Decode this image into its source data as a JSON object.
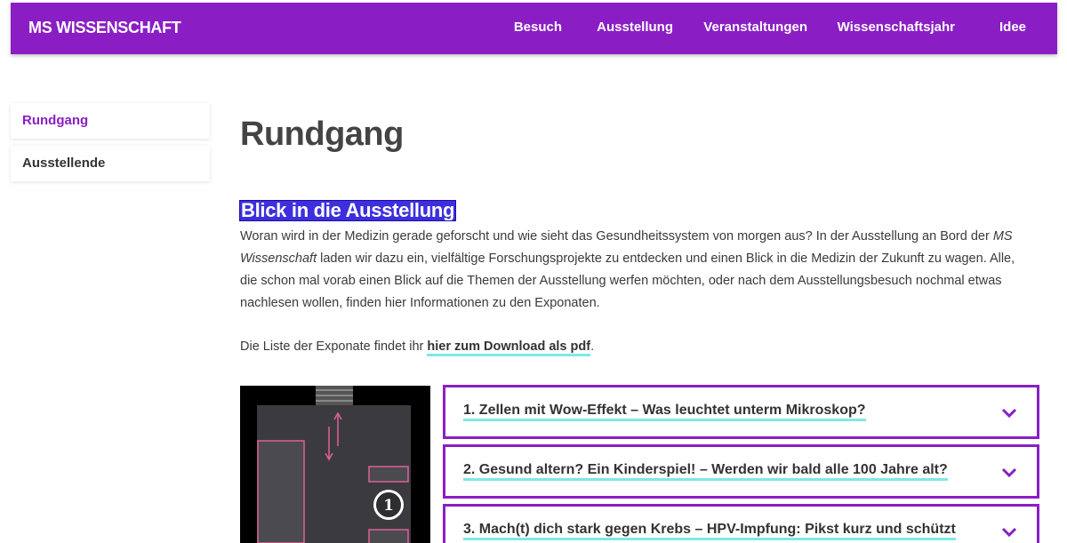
{
  "header": {
    "brand": "MS WISSENSCHAFT",
    "nav": [
      "Besuch",
      "Ausstellung",
      "Veranstaltungen",
      "Wissenschaftsjahr",
      "Idee"
    ],
    "bg_color": "#8a1ec4"
  },
  "sidebar": {
    "items": [
      {
        "label": "Rundgang",
        "active": true
      },
      {
        "label": "Ausstellende",
        "active": false
      }
    ]
  },
  "main": {
    "title": "Rundgang",
    "section_title": "Blick in die Ausstellung",
    "intro_before": "Woran wird in der Medizin gerade geforscht und wie sieht das Gesundheitssystem von morgen aus? In der Ausstellung an Bord der ",
    "intro_em": "MS Wissenschaft",
    "intro_after": " laden wir dazu ein, vielfältige Forschungsprojekte zu entdecken und einen Blick in die Medizin der Zukunft zu wagen. Alle, die schon mal vorab einen Blick auf die Themen der Ausstellung werfen möchten, oder nach dem Ausstellungsbesuch nochmal etwas nachlesen wollen, finden hier Informationen zu den Exponaten.",
    "download_prefix": "Die Liste der Exponate findet ihr ",
    "download_link": "hier zum Download als pdf",
    "download_suffix": "."
  },
  "map": {
    "marker": "1"
  },
  "accordion": [
    "1. Zellen mit Wow-Effekt – Was leuchtet unterm Mikroskop?",
    "2. Gesund altern? Ein Kinderspiel! – Werden wir bald alle 100 Jahre alt?",
    "3. Mach(t) dich stark gegen Krebs – HPV-Impfung: Pikst kurz und schützt"
  ],
  "icons": {
    "chevron": "chevron-down-icon",
    "accent": "#8a1ec4",
    "underline": "#7de8e8"
  }
}
